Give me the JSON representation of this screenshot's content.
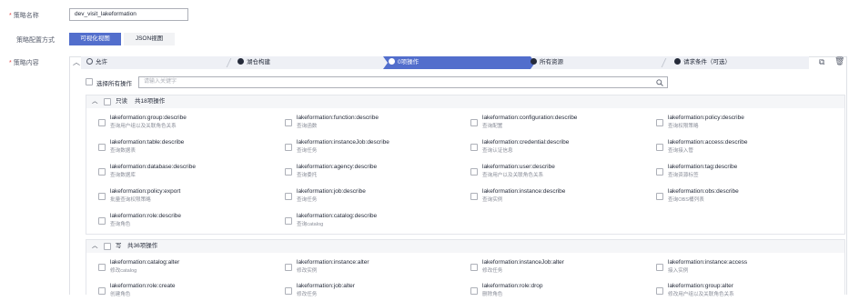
{
  "form": {
    "name_label": "策略名称",
    "name_value": "dev_visit_lakeformation",
    "mode_label": "策略配置方式",
    "mode_options": [
      "可视化视图",
      "JSON视图"
    ],
    "content_label": "策略内容"
  },
  "steps": [
    "允许",
    "湖仓构建",
    "0项操作",
    "所有资源",
    "请求条件（可选）"
  ],
  "search": {
    "select_all_label": "选择所有操作",
    "placeholder": "请输入关键字"
  },
  "groups": [
    {
      "title": "只读",
      "count": "共18项操作",
      "items": [
        {
          "name": "lakeformation:group:describe",
          "desc": "查询用户组以及关联角色关系"
        },
        {
          "name": "lakeformation:function:describe",
          "desc": "查询函数"
        },
        {
          "name": "lakeformation:configuration:describe",
          "desc": "查询配置"
        },
        {
          "name": "lakeformation:policy:describe",
          "desc": "查询权限策略"
        },
        {
          "name": "lakeformation:table:describe",
          "desc": "查询数据表"
        },
        {
          "name": "lakeformation:instanceJob:describe",
          "desc": "查询任务"
        },
        {
          "name": "lakeformation:credential:describe",
          "desc": "查询认证信息"
        },
        {
          "name": "lakeformation:access:describe",
          "desc": "查询接入管"
        },
        {
          "name": "lakeformation:database:describe",
          "desc": "查询数据库"
        },
        {
          "name": "lakeformation:agency:describe",
          "desc": "查询委托"
        },
        {
          "name": "lakeformation:user:describe",
          "desc": "查询用户以及关联角色关系"
        },
        {
          "name": "lakeformation:tag:describe",
          "desc": "查询资源标签"
        },
        {
          "name": "lakeformation:policy:export",
          "desc": "批量查询权限策略"
        },
        {
          "name": "lakeformation:job:describe",
          "desc": "查询任务"
        },
        {
          "name": "lakeformation:instance:describe",
          "desc": "查询实例"
        },
        {
          "name": "lakeformation:obs:describe",
          "desc": "查询OBS桶列表"
        },
        {
          "name": "lakeformation:role:describe",
          "desc": "查询角色"
        },
        {
          "name": "lakeformation:catalog:describe",
          "desc": "查询catalog"
        }
      ]
    },
    {
      "title": "写",
      "count": "共36项操作",
      "items": [
        {
          "name": "lakeformation:catalog:alter",
          "desc": "修改catalog"
        },
        {
          "name": "lakeformation:instance:alter",
          "desc": "修改实例"
        },
        {
          "name": "lakeformation:instanceJob:alter",
          "desc": "修改任务"
        },
        {
          "name": "lakeformation:instance:access",
          "desc": "接入实例"
        },
        {
          "name": "lakeformation:role:create",
          "desc": "创建角色"
        },
        {
          "name": "lakeformation:job:alter",
          "desc": "修改任务"
        },
        {
          "name": "lakeformation:role:drop",
          "desc": "删除角色"
        },
        {
          "name": "lakeformation:group:alter",
          "desc": "修改用户组以及关联角色关系"
        }
      ]
    }
  ]
}
